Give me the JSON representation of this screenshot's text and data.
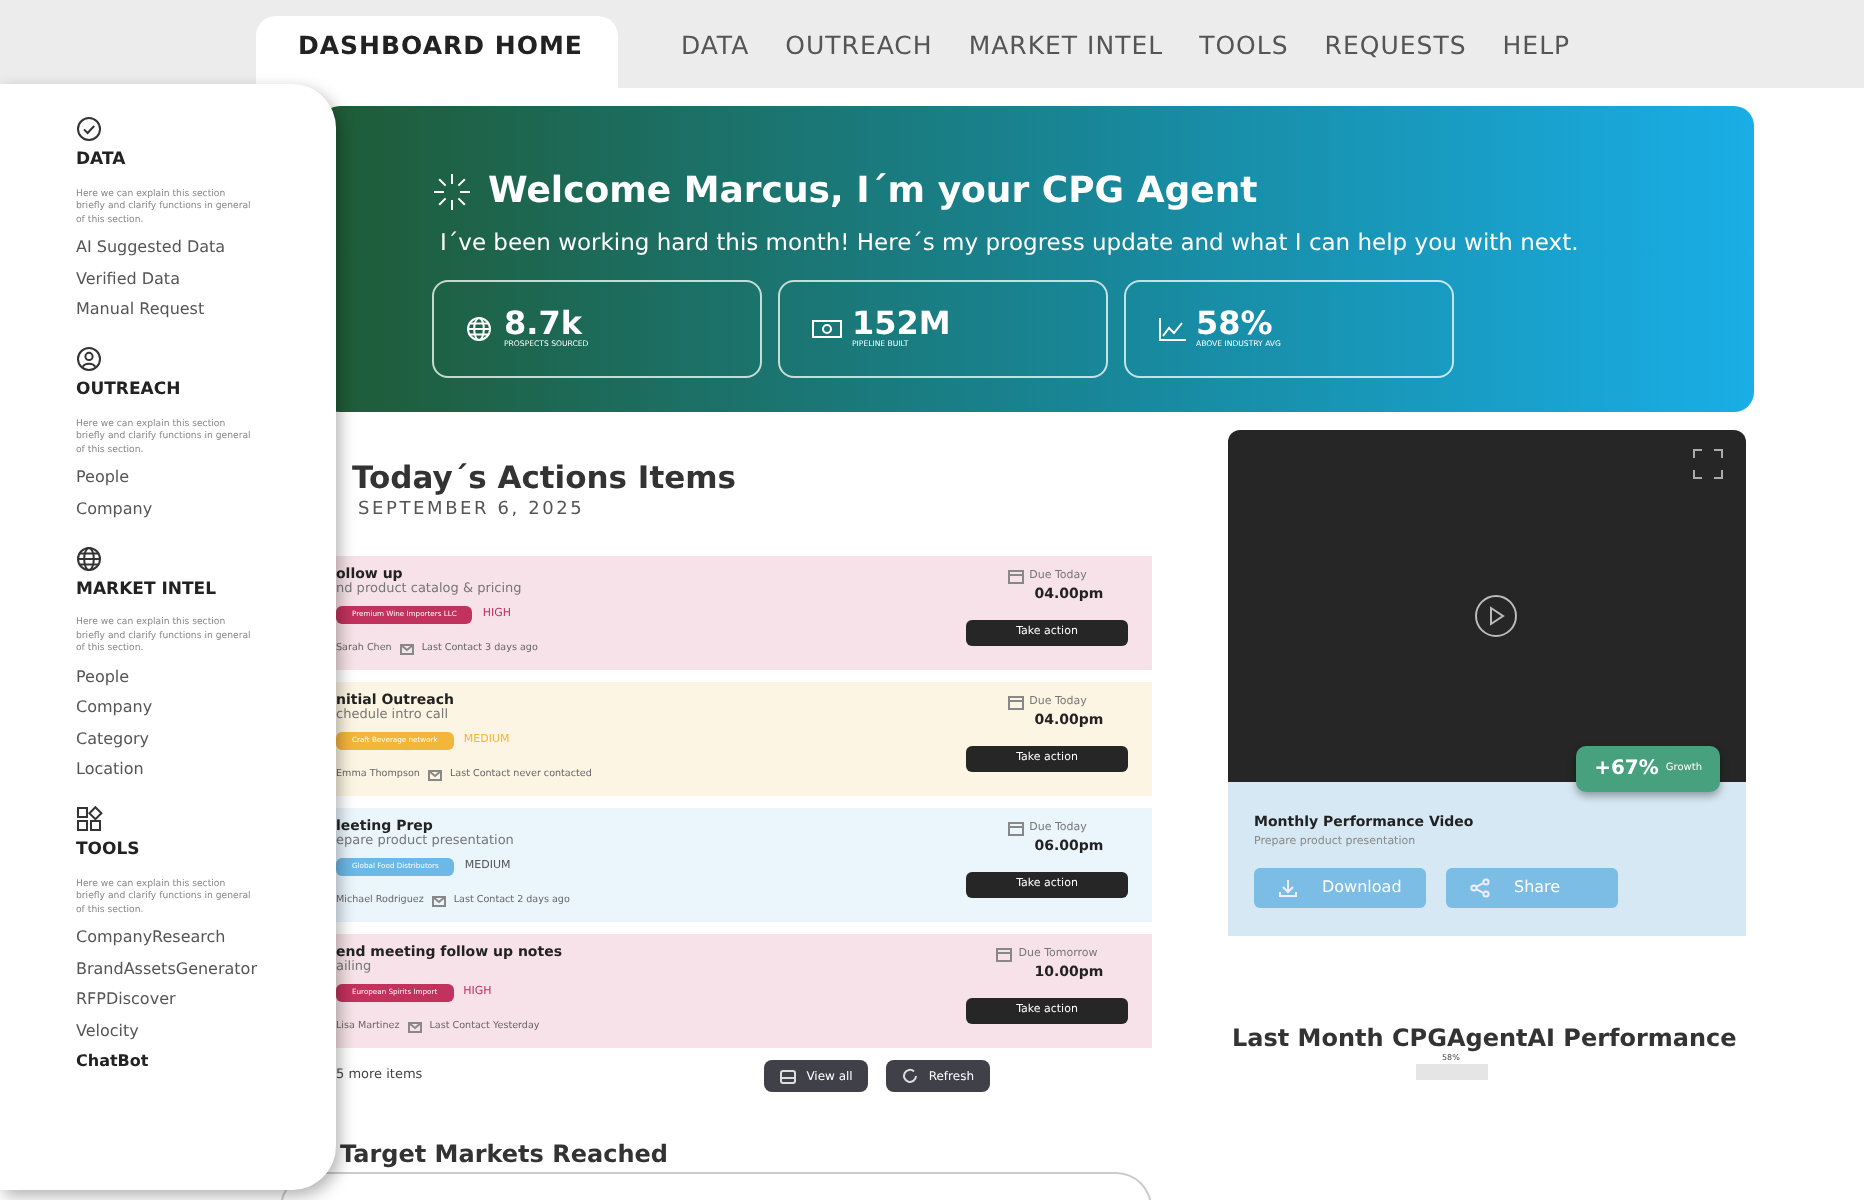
{
  "nav": {
    "tabs": [
      {
        "label": "DASHBOARD HOME",
        "selected": true
      },
      {
        "label": "DATA",
        "selected": false
      },
      {
        "label": "OUTREACH",
        "selected": false
      },
      {
        "label": "MARKET INTEL",
        "selected": false
      },
      {
        "label": "TOOLS",
        "selected": false
      },
      {
        "label": "REQUESTS",
        "selected": false
      },
      {
        "label": "HELP",
        "selected": false
      }
    ]
  },
  "sidebar": {
    "sections": [
      {
        "kind": "check",
        "title": "DATA",
        "description": "Here we can explain this section briefly and clarify functions in general of this section.",
        "items": [
          {
            "label": "AI Suggested Data",
            "selected": false
          },
          {
            "label": "Verified Data",
            "selected": false
          },
          {
            "label": "Manual Request",
            "selected": false
          }
        ]
      },
      {
        "kind": "user",
        "title": "OUTREACH",
        "description": "Here we can explain this section briefly and clarify functions in general of this section.",
        "items": [
          {
            "label": "People",
            "selected": false
          },
          {
            "label": "Company",
            "selected": false
          }
        ]
      },
      {
        "kind": "globe",
        "title": "MARKET INTEL",
        "description": "Here we can explain this section briefly and clarify functions in general of this section.",
        "items": [
          {
            "label": "People",
            "selected": false
          },
          {
            "label": "Company",
            "selected": false
          },
          {
            "label": "Category",
            "selected": false
          },
          {
            "label": "Location",
            "selected": false
          }
        ]
      },
      {
        "kind": "tools",
        "title": "TOOLS",
        "description": "Here we can explain this section briefly and clarify functions in general of this section.",
        "items": [
          {
            "label": "CompanyResearch",
            "selected": false
          },
          {
            "label": "BrandAssetsGenerator",
            "selected": false
          },
          {
            "label": "RFPDiscover",
            "selected": false
          },
          {
            "label": "Velocity",
            "selected": false
          },
          {
            "label": "ChatBot",
            "selected": true
          }
        ]
      }
    ]
  },
  "hero": {
    "title": "Welcome Marcus, I´m your CPG Agent",
    "subtitle": "I´ve been working hard this month! Here´s my progress update and what I can help you with next.",
    "stats": [
      {
        "kind": "globe",
        "value": "8.7k",
        "label": "PROSPECTS SOURCED"
      },
      {
        "kind": "money",
        "value": "152M",
        "label": "PIPELINE BUILT"
      },
      {
        "kind": "trend",
        "value": "58%",
        "label": "ABOVE INDUSTRY AVG"
      }
    ]
  },
  "actions": {
    "title": "Today´s Actions Items",
    "date": "SEPTEMBER 6, 2025",
    "items": [
      {
        "title": "ollow up",
        "subtitle": "nd product catalog & pricing",
        "company": "Premium Wine Importers LLC",
        "color": "#c2325e",
        "priority": "HIGH",
        "priority_tinted": true,
        "person": "Sarah Chen",
        "last_contact": "Last Contact 3 days ago",
        "due_label": "Due Today",
        "due_time": "04.00pm",
        "button": "Take action"
      },
      {
        "title": "nitial Outreach",
        "subtitle": "chedule intro call",
        "company": "Craft Beverage network",
        "color": "#f4b63a",
        "priority": "MEDIUM",
        "priority_tinted": true,
        "person": "Emma Thompson",
        "last_contact": "Last Contact never contacted",
        "due_label": "Due Today",
        "due_time": "04.00pm",
        "button": "Take action"
      },
      {
        "title": "leeting Prep",
        "subtitle": "epare product presentation",
        "company": "Global Food Distributors",
        "color": "#6cb8e6",
        "priority": "MEDIUM",
        "priority_tinted": false,
        "person": "Michael Rodriguez",
        "last_contact": "Last Contact 2 days ago",
        "due_label": "Due Today",
        "due_time": "06.00pm",
        "button": "Take action"
      },
      {
        "title": "end meeting follow up notes",
        "subtitle": "ailing",
        "company": "European Spirits Import",
        "color": "#c2325e",
        "priority": "HIGH",
        "priority_tinted": true,
        "person": "Lisa Martinez",
        "last_contact": "Last Contact Yesterday",
        "due_label": "Due Tomorrow",
        "due_time": "10.00pm",
        "button": "Take action"
      }
    ],
    "more": "5 more items",
    "view_all": "View all",
    "refresh": "Refresh"
  },
  "video": {
    "growth": "+67%",
    "growth_label": "Growth",
    "title": "Monthly Performance Video",
    "subtitle": "Prepare product presentation",
    "download": "Download",
    "share": "Share"
  },
  "target_markets": {
    "title": "Target Markets Reached"
  },
  "performance": {
    "title": "Last Month CPGAgentAI Performance",
    "reading": "58%"
  }
}
